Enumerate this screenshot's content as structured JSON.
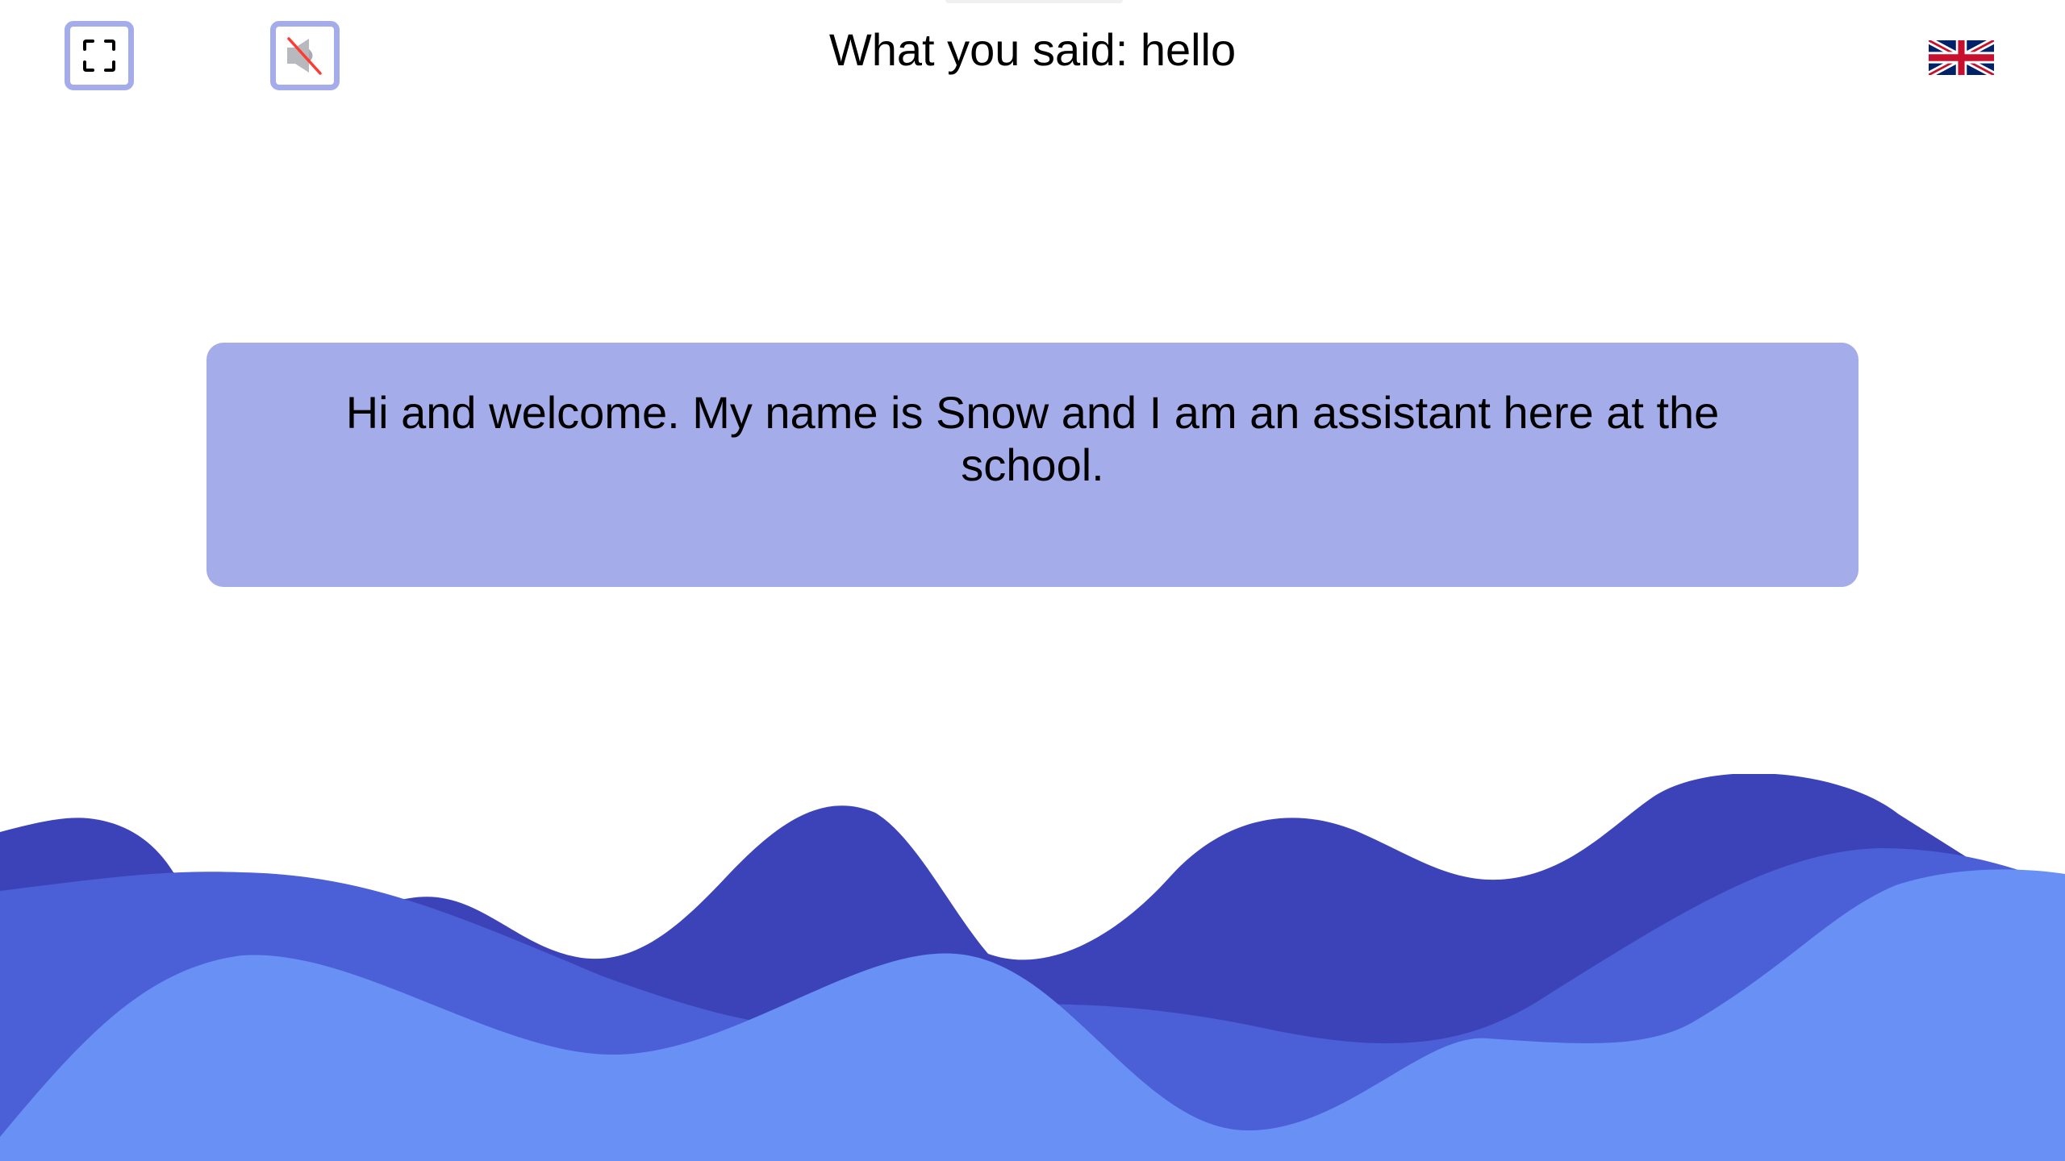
{
  "header": {
    "transcript_text": "What you said: hello",
    "fullscreen_icon": "fullscreen-icon",
    "mute_icon": "speaker-muted-icon",
    "language_icon": "uk-flag-icon"
  },
  "assistant": {
    "message": "Hi and welcome. My name is Snow and I am an assistant here at the school."
  },
  "colors": {
    "button_border": "#a4acec",
    "message_background": "#a4acea",
    "wave_back": "#3c43b9",
    "wave_middle": "#4b5fd6",
    "wave_front": "#6890f5",
    "mute_slash": "#ff3b30"
  }
}
